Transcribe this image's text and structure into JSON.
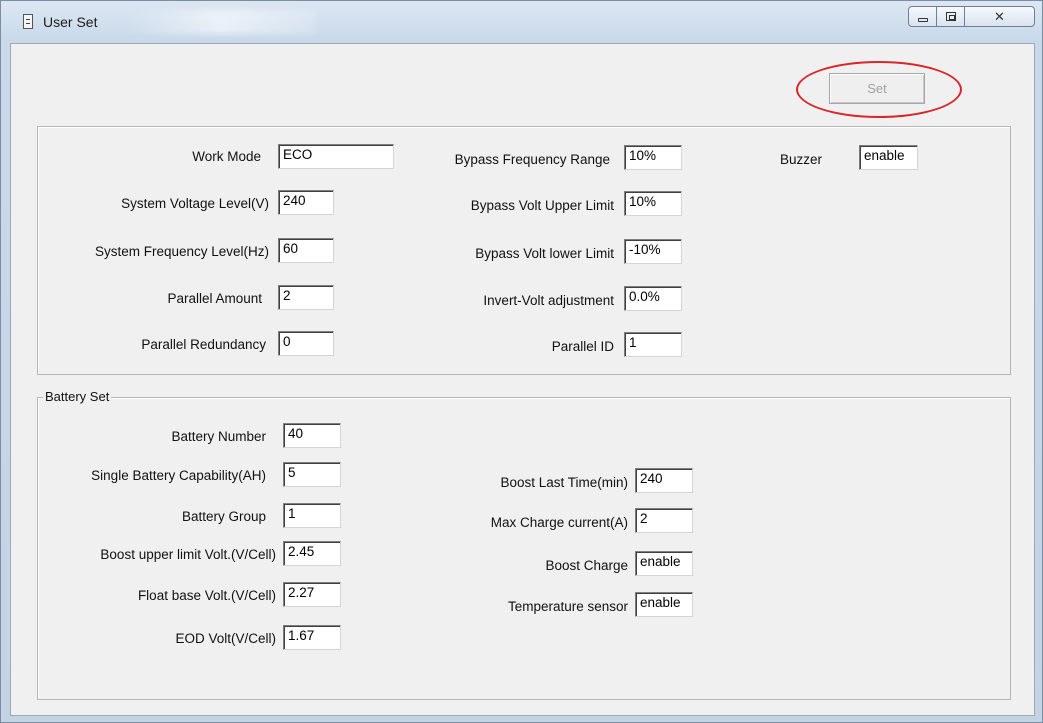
{
  "window": {
    "title": "User Set"
  },
  "toolbar": {
    "set_label": "Set"
  },
  "system": {
    "work_mode": {
      "label": "Work Mode",
      "value": "ECO"
    },
    "system_voltage_level": {
      "label": "System Voltage Level(V)",
      "value": "240"
    },
    "system_frequency_level": {
      "label": "System Frequency Level(Hz)",
      "value": "60"
    },
    "parallel_amount": {
      "label": "Parallel Amount",
      "value": "2"
    },
    "parallel_redundancy": {
      "label": "Parallel Redundancy",
      "value": "0"
    },
    "bypass_frequency_range": {
      "label": "Bypass Frequency Range",
      "value": "10%"
    },
    "bypass_volt_upper_limit": {
      "label": "Bypass Volt Upper Limit",
      "value": "10%"
    },
    "bypass_volt_lower_limit": {
      "label": "Bypass Volt lower Limit",
      "value": "-10%"
    },
    "invert_volt_adjustment": {
      "label": "Invert-Volt adjustment",
      "value": "0.0%"
    },
    "parallel_id": {
      "label": "Parallel ID",
      "value": "1"
    },
    "buzzer": {
      "label": "Buzzer",
      "value": "enable"
    }
  },
  "battery": {
    "group_title": "Battery Set",
    "battery_number": {
      "label": "Battery Number",
      "value": "40"
    },
    "single_battery_capability": {
      "label": "Single Battery Capability(AH)",
      "value": "5"
    },
    "battery_group": {
      "label": "Battery Group",
      "value": "1"
    },
    "boost_upper_limit_volt": {
      "label": "Boost upper limit Volt.(V/Cell)",
      "value": "2.45"
    },
    "float_base_volt": {
      "label": "Float base Volt.(V/Cell)",
      "value": "2.27"
    },
    "eod_volt": {
      "label": "EOD Volt(V/Cell)",
      "value": "1.67"
    },
    "boost_last_time": {
      "label": "Boost Last Time(min)",
      "value": "240"
    },
    "max_charge_current": {
      "label": "Max Charge current(A)",
      "value": "2"
    },
    "boost_charge": {
      "label": "Boost Charge",
      "value": "enable"
    },
    "temperature_sensor": {
      "label": "Temperature sensor",
      "value": "enable"
    }
  },
  "colors": {
    "highlight_ring": "#d9262a",
    "client_bg": "#f0f0f0",
    "disabled_text": "#a0a0a0"
  },
  "icons": {
    "app": "document-icon",
    "minimize": "minimize-icon",
    "maximize": "maximize-icon",
    "close": "close-icon"
  }
}
